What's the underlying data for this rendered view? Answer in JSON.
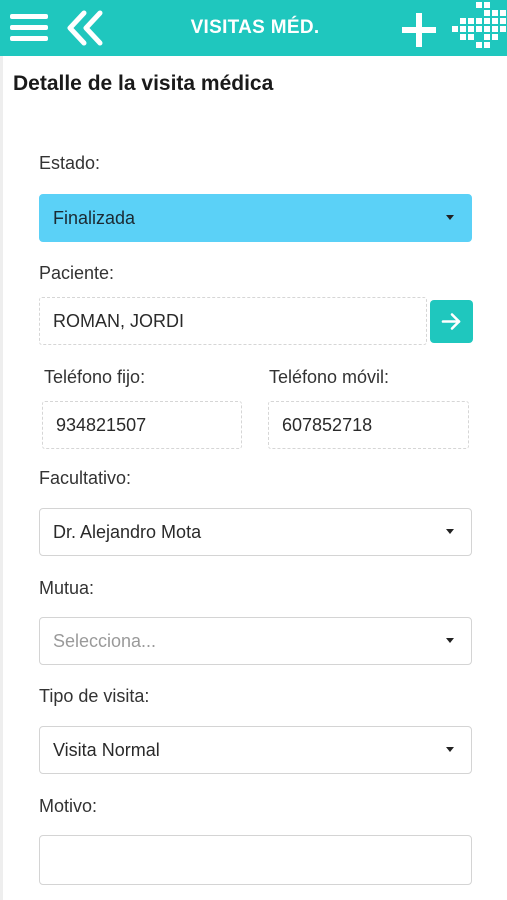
{
  "header": {
    "title": "VISITAS MÉD.",
    "menu_icon": "hamburger-menu-icon",
    "back_icon": "double-chevron-left-icon",
    "add_icon": "plus-icon",
    "logo_icon": "app-logo-icon",
    "background_color": "#1fc7be"
  },
  "page": {
    "title": "Detalle de la visita médica"
  },
  "form": {
    "estado": {
      "label": "Estado:",
      "value": "Finalizada",
      "color": "#5bd1f7"
    },
    "paciente": {
      "label": "Paciente:",
      "value": "ROMAN, JORDI",
      "go_icon": "arrow-right-icon"
    },
    "telefono_fijo": {
      "label": "Teléfono fijo:",
      "value": "934821507"
    },
    "telefono_movil": {
      "label": "Teléfono móvil:",
      "value": "607852718"
    },
    "facultativo": {
      "label": "Facultativo:",
      "value": "Dr. Alejandro Mota"
    },
    "mutua": {
      "label": "Mutua:",
      "placeholder": "Selecciona..."
    },
    "tipo_visita": {
      "label": "Tipo de visita:",
      "value": "Visita Normal"
    },
    "motivo": {
      "label": "Motivo:",
      "value": ""
    }
  }
}
